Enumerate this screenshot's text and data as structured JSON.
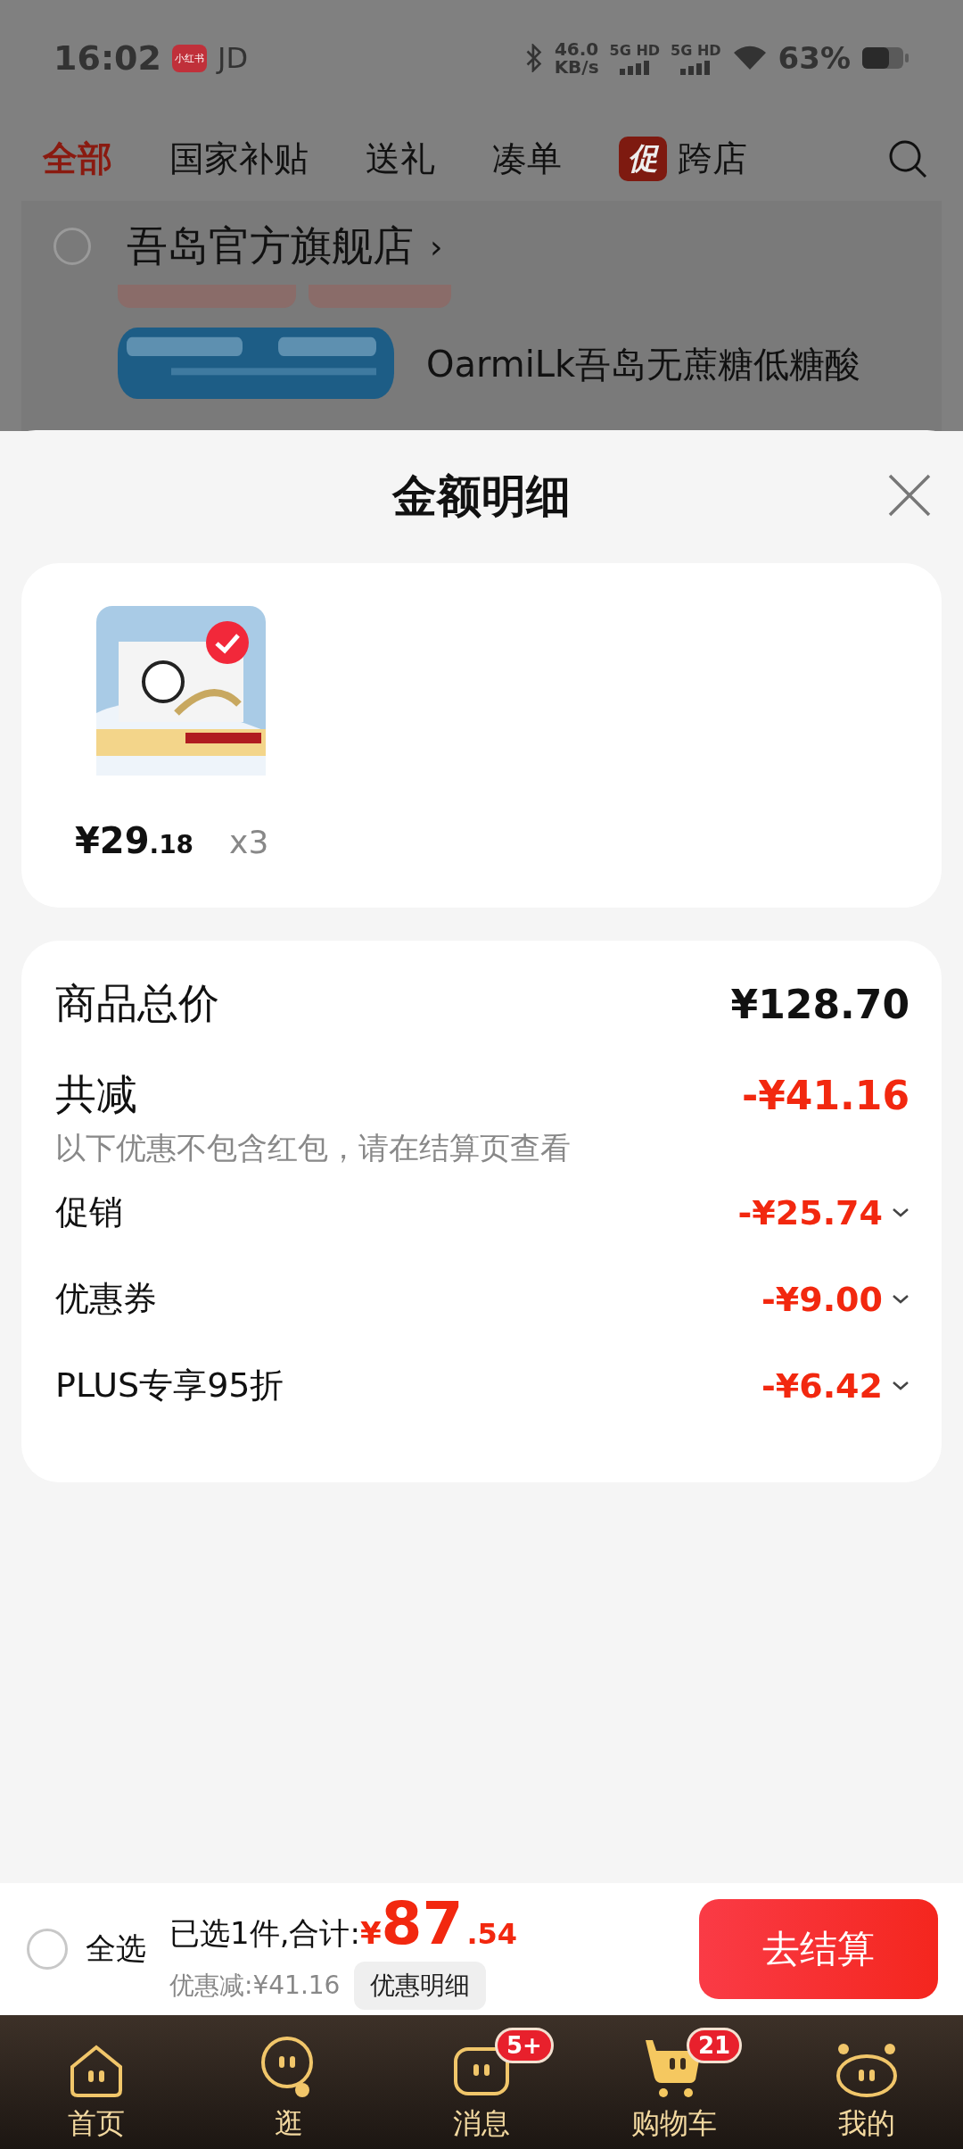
{
  "status_bar": {
    "time": "16:02",
    "app_badge": "小红书",
    "carrier": "JD",
    "net_speed": "46.0",
    "net_unit": "KB/s",
    "sim_labels": [
      "5G HD",
      "5G HD"
    ],
    "battery": "63%"
  },
  "tabs": [
    {
      "label": "全部",
      "selected": true
    },
    {
      "label": "国家补贴",
      "selected": false
    },
    {
      "label": "送礼",
      "selected": false
    },
    {
      "label": "凑单",
      "selected": false
    },
    {
      "label": "跨店",
      "selected": false,
      "badge": "促"
    }
  ],
  "store": {
    "name": "吾岛官方旗舰店",
    "chevron": "›",
    "checked": false,
    "product_title": "OarmiLk吾岛无蔗糖低糖酸"
  },
  "sheet": {
    "title": "金额明细",
    "items": [
      {
        "kind": "picture",
        "price_main": "¥29",
        "price_decimal": ".18",
        "quantity": "x3",
        "checked": true
      }
    ],
    "total_label": "商品总价",
    "total": "¥128.70",
    "discount_label": "共减",
    "discount": "-¥41.16",
    "note": "以下优惠不包含红包，请在结算页查看",
    "rows": [
      {
        "label": "促销",
        "amount": "-¥25.74"
      },
      {
        "label": "优惠券",
        "amount": "-¥9.00"
      },
      {
        "label": "PLUS专享95折",
        "amount": "-¥6.42"
      }
    ]
  },
  "checkout": {
    "select_all_label": "全选",
    "select_all_checked": false,
    "selected_text": "已选1件,合计:",
    "currency": "¥",
    "amount_int": "87",
    "amount_dec": ".54",
    "saved": "优惠减:¥41.16",
    "detail_button": "优惠明细",
    "checkout_button": "去结算"
  },
  "nav": [
    {
      "kind": "home",
      "label": "首页"
    },
    {
      "kind": "explore",
      "label": "逛"
    },
    {
      "kind": "message",
      "label": "消息",
      "badge": "5+"
    },
    {
      "kind": "cart",
      "label": "购物车",
      "badge": "21"
    },
    {
      "kind": "me",
      "label": "我的"
    }
  ]
}
